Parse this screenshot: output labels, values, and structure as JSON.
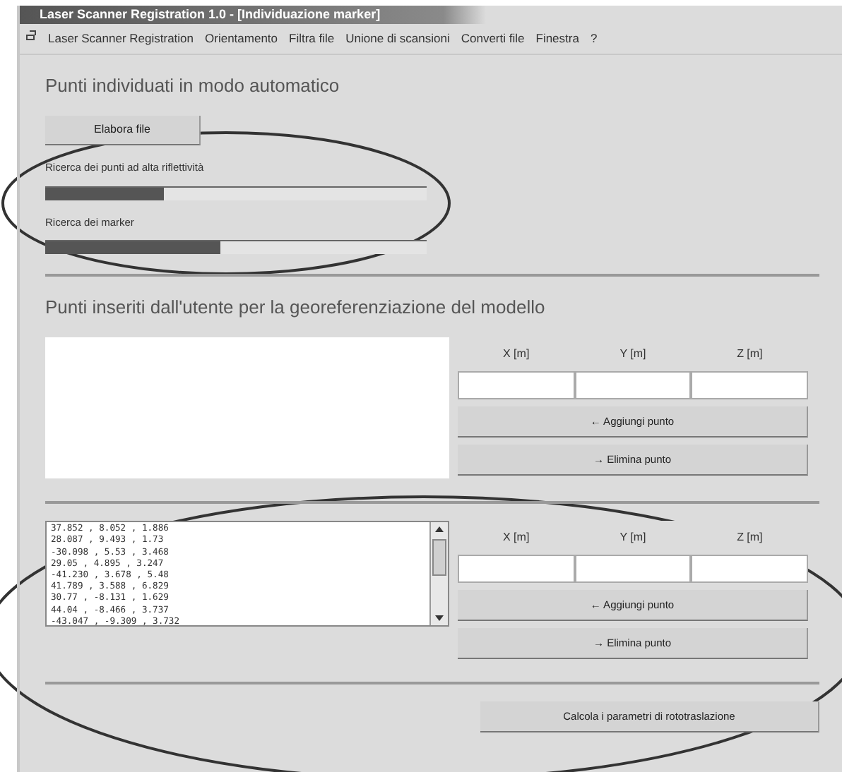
{
  "window": {
    "title": "Laser Scanner Registration 1.0 - [Individuazione marker]"
  },
  "menu": [
    "Laser Scanner Registration",
    "Orientamento",
    "Filtra file",
    "Unione di scansioni",
    "Converti file",
    "Finestra",
    "?"
  ],
  "automatic": {
    "heading": "Punti individuati in modo automatico",
    "button": "Elabora file",
    "circled": true,
    "progress": [
      {
        "label": "Ricerca dei punti ad alta riflettività",
        "level": 0.31
      },
      {
        "label": "Ricerca dei marker",
        "level": 0.46
      }
    ]
  },
  "manual": {
    "heading": "Punti inseriti dall'utente per la georeferenziazione del modello",
    "panels": [
      {
        "circled": false,
        "columns": [
          "X [m]",
          "Y [m]",
          "Z [m]"
        ],
        "add": "← Aggiungi punto",
        "remove": "→ Elimina punto"
      },
      {
        "circled": true,
        "rows": [
          "37.852 , 8.052 , 1.886",
          "28.087 , 9.493 , 1.73",
          "-30.098 , 5.53 , 3.468",
          "29.05 , 4.895 , 3.247",
          "-41.230 , 3.678 , 5.48",
          "41.789 , 3.588 , 6.829",
          "30.77 , -8.131 , 1.629",
          "44.04 , -8.466 , 3.737",
          "-43.047 , -9.309 , 3.732"
        ],
        "columns": [
          "X [m]",
          "Y [m]",
          "Z [m]"
        ],
        "add": "← Aggiungi punto",
        "remove": "→ Elimina punto"
      }
    ],
    "calculate": "Calcola i parametri di rototraslazione"
  }
}
